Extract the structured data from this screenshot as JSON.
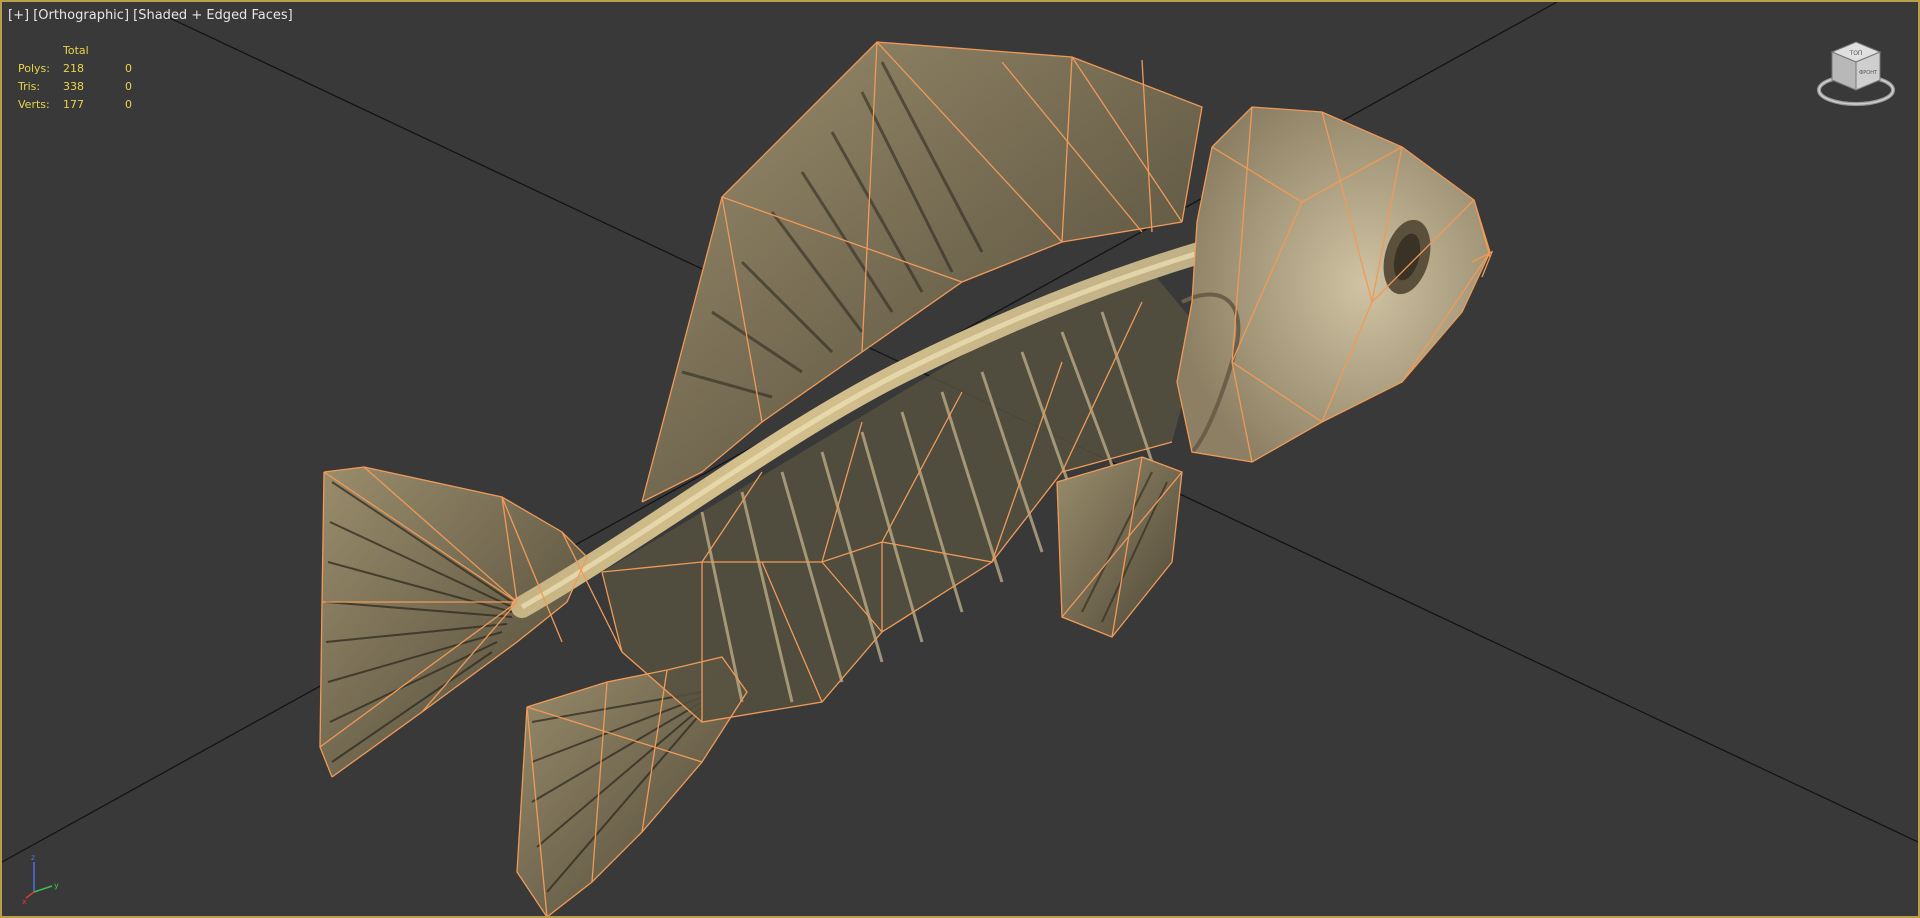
{
  "viewport": {
    "label_parts": [
      "[+]",
      "[Orthographic]",
      "[Shaded + Edged Faces]"
    ]
  },
  "stats": {
    "header": "Total",
    "rows": [
      {
        "label": "Polys:",
        "total": "218",
        "selected": "0"
      },
      {
        "label": "Tris:",
        "total": "338",
        "selected": "0"
      },
      {
        "label": "Verts:",
        "total": "177",
        "selected": "0"
      }
    ]
  },
  "viewcube": {
    "top_face": "ТОП",
    "front_face": "ФРОНТ"
  },
  "axis_tripod": {
    "x_label": "x",
    "y_label": "y",
    "z_label": "z"
  },
  "colors": {
    "viewport_border": "#b8a04a",
    "background": "#393939",
    "wire": "#f09a58",
    "stats_text": "#e8d44d",
    "bone": "#c9b98a"
  },
  "icons": [
    "viewcube-icon",
    "axis-tripod-icon"
  ]
}
